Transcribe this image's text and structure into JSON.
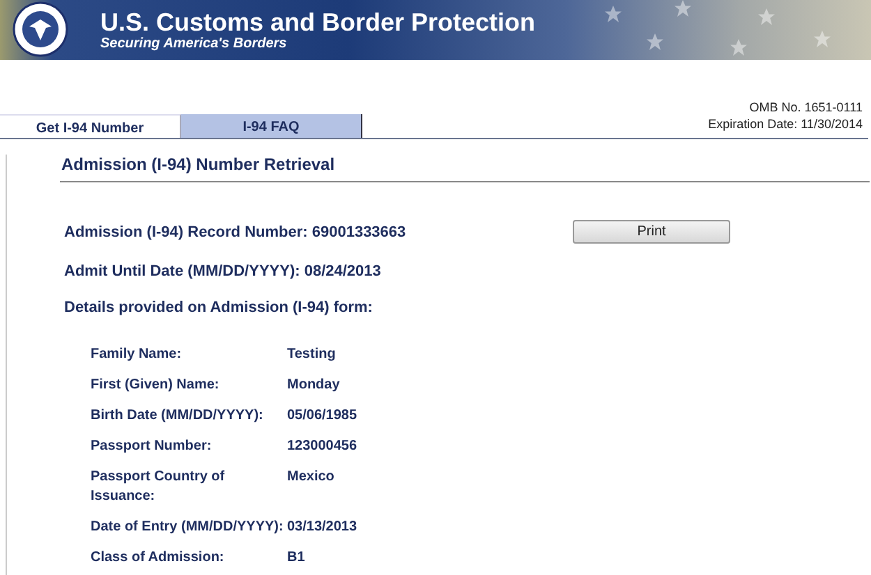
{
  "header": {
    "title": "U.S. Customs and Border Protection",
    "tagline": "Securing America's Borders"
  },
  "tabs": [
    {
      "label": "Get I-94 Number",
      "selected": true
    },
    {
      "label": "I-94 FAQ",
      "selected": false
    }
  ],
  "omb": {
    "number": "OMB No. 1651-0111",
    "expiration": "Expiration Date: 11/30/2014"
  },
  "section_title": "Admission (I-94) Number Retrieval",
  "record_number": "Admission (I-94) Record Number: 69001333663",
  "print_button": "Print",
  "admit_until": "Admit Until Date (MM/DD/YYYY): 08/24/2013",
  "details_heading": "Details provided on Admission (I-94) form:",
  "details": [
    {
      "label": "Family Name:",
      "value": "Testing"
    },
    {
      "label": "First (Given) Name:",
      "value": "Monday"
    },
    {
      "label": "Birth Date (MM/DD/YYYY):",
      "value": "05/06/1985"
    },
    {
      "label": "Passport Number:",
      "value": "123000456"
    },
    {
      "label": "Passport Country of Issuance:",
      "value": "Mexico"
    },
    {
      "label": "Date of Entry (MM/DD/YYYY):",
      "value": "03/13/2013"
    },
    {
      "label": "Class of Admission:",
      "value": "B1"
    }
  ]
}
